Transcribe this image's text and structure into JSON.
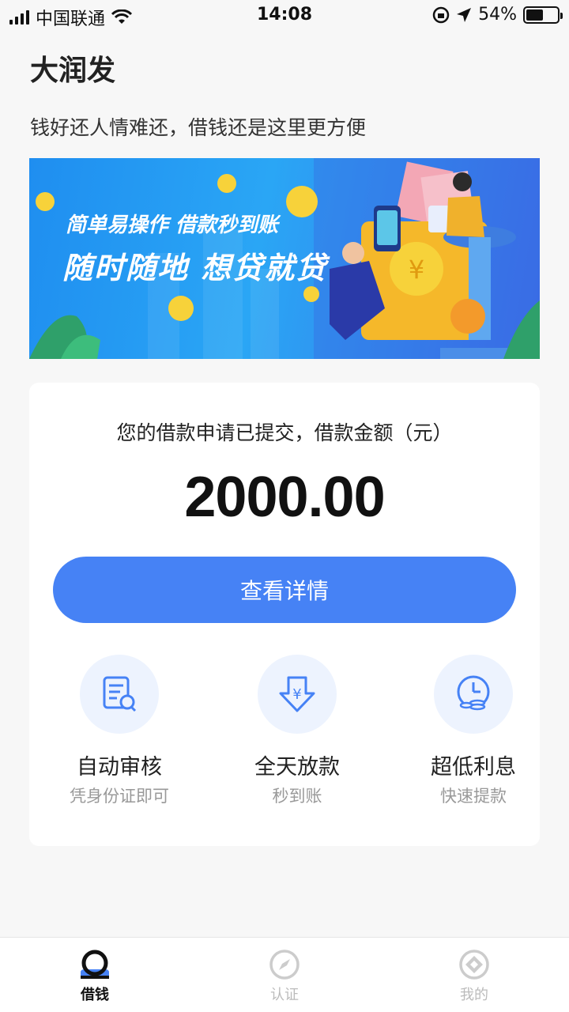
{
  "status_bar": {
    "carrier": "中国联通",
    "time": "14:08",
    "battery": "54%",
    "battery_level": 0.54
  },
  "header": {
    "title": "大润发",
    "subtitle": "钱好还人情难还，借钱还是这里更方便"
  },
  "banner": {
    "line1": "简单易操作 借款秒到账",
    "line2": "随时随地 想贷就贷"
  },
  "card": {
    "notice": "您的借款申请已提交，借款金额（元）",
    "amount": "2000.00",
    "button_label": "查看详情",
    "features": [
      {
        "title": "自动审核",
        "subtitle": "凭身份证即可",
        "icon": "document-search-icon"
      },
      {
        "title": "全天放款",
        "subtitle": "秒到账",
        "icon": "yuan-arrow-down-icon"
      },
      {
        "title": "超低利息",
        "subtitle": "快速提款",
        "icon": "clock-coins-icon"
      }
    ]
  },
  "tabbar": {
    "tabs": [
      {
        "label": "借钱",
        "icon": "borrow-icon",
        "active": true
      },
      {
        "label": "认证",
        "icon": "compass-icon",
        "active": false
      },
      {
        "label": "我的",
        "icon": "profile-icon",
        "active": false
      }
    ]
  },
  "colors": {
    "accent": "#4682f5",
    "feature_bg": "#edf3fe",
    "banner_bg": "#2aa6f5"
  }
}
